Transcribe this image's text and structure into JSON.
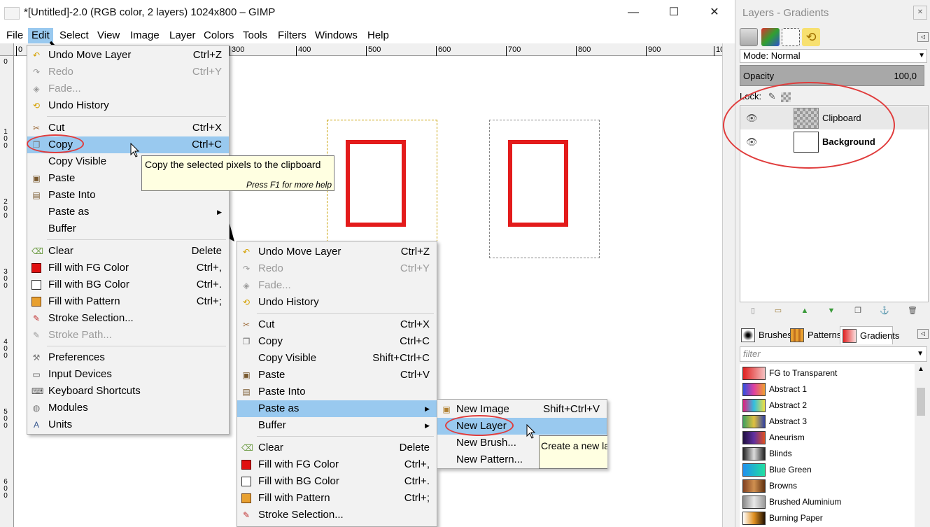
{
  "window": {
    "title": "*[Untitled]-2.0 (RGB color, 2 layers) 1024x800 – GIMP",
    "minimize": "—",
    "maximize": "☐",
    "close": "✕"
  },
  "menubar": [
    "File",
    "Edit",
    "Select",
    "View",
    "Image",
    "Layer",
    "Colors",
    "Tools",
    "Filters",
    "Windows",
    "Help"
  ],
  "ruler_h": [
    "0",
    "300",
    "400",
    "500",
    "600",
    "700",
    "800",
    "900",
    "10"
  ],
  "ruler_v": [
    "0",
    "100",
    "200",
    "300",
    "400",
    "500",
    "600"
  ],
  "edit_menu": [
    {
      "icon": "undo-icon",
      "label": "Undo Move Layer",
      "accel": "Ctrl+Z"
    },
    {
      "icon": "redo-icon",
      "label": "Redo",
      "accel": "Ctrl+Y",
      "disabled": true
    },
    {
      "icon": "fade-icon",
      "label": "Fade...",
      "accel": "",
      "disabled": true
    },
    {
      "icon": "undo-history-icon",
      "label": "Undo History",
      "accel": ""
    },
    {
      "icon": "cut-icon",
      "label": "Cut",
      "accel": "Ctrl+X"
    },
    {
      "icon": "copy-icon",
      "label": "Copy",
      "accel": "Ctrl+C",
      "highlighted": true
    },
    {
      "icon": "",
      "label": "Copy Visible",
      "accel": ""
    },
    {
      "icon": "paste-icon",
      "label": "Paste",
      "accel": ""
    },
    {
      "icon": "paste-into-icon",
      "label": "Paste Into",
      "accel": ""
    },
    {
      "icon": "",
      "label": "Paste as",
      "accel": "",
      "submenu": true
    },
    {
      "icon": "",
      "label": "Buffer",
      "accel": ""
    },
    {
      "icon": "clear-icon",
      "label": "Clear",
      "accel": "Delete"
    },
    {
      "icon": "fg-color-icon",
      "label": "Fill with FG Color",
      "accel": "Ctrl+,"
    },
    {
      "icon": "bg-color-icon",
      "label": "Fill with BG Color",
      "accel": "Ctrl+."
    },
    {
      "icon": "pattern-icon",
      "label": "Fill with Pattern",
      "accel": "Ctrl+;"
    },
    {
      "icon": "stroke-selection-icon",
      "label": "Stroke Selection...",
      "accel": ""
    },
    {
      "icon": "stroke-path-icon",
      "label": "Stroke Path...",
      "accel": "",
      "disabled": true
    },
    {
      "icon": "preferences-icon",
      "label": "Preferences",
      "accel": ""
    },
    {
      "icon": "input-devices-icon",
      "label": "Input Devices",
      "accel": ""
    },
    {
      "icon": "keyboard-icon",
      "label": "Keyboard Shortcuts",
      "accel": ""
    },
    {
      "icon": "modules-icon",
      "label": "Modules",
      "accel": ""
    },
    {
      "icon": "units-icon",
      "label": "Units",
      "accel": ""
    }
  ],
  "edit_menu2": [
    {
      "icon": "undo-icon",
      "label": "Undo Move Layer",
      "accel": "Ctrl+Z"
    },
    {
      "icon": "redo-icon",
      "label": "Redo",
      "accel": "Ctrl+Y",
      "disabled": true
    },
    {
      "icon": "fade-icon",
      "label": "Fade...",
      "accel": "",
      "disabled": true
    },
    {
      "icon": "undo-history-icon",
      "label": "Undo History",
      "accel": ""
    },
    {
      "icon": "cut-icon",
      "label": "Cut",
      "accel": "Ctrl+X"
    },
    {
      "icon": "copy-icon",
      "label": "Copy",
      "accel": "Ctrl+C"
    },
    {
      "icon": "",
      "label": "Copy Visible",
      "accel": "Shift+Ctrl+C"
    },
    {
      "icon": "paste-icon",
      "label": "Paste",
      "accel": "Ctrl+V"
    },
    {
      "icon": "paste-into-icon",
      "label": "Paste Into",
      "accel": ""
    },
    {
      "icon": "",
      "label": "Paste as",
      "accel": "",
      "submenu": true,
      "highlighted": true
    },
    {
      "icon": "",
      "label": "Buffer",
      "accel": "",
      "submenu": true
    },
    {
      "icon": "clear-icon",
      "label": "Clear",
      "accel": "Delete"
    },
    {
      "icon": "fg-color-icon",
      "label": "Fill with FG Color",
      "accel": "Ctrl+,"
    },
    {
      "icon": "bg-color-icon",
      "label": "Fill with BG Color",
      "accel": "Ctrl+."
    },
    {
      "icon": "pattern-icon",
      "label": "Fill with Pattern",
      "accel": "Ctrl+;"
    },
    {
      "icon": "stroke-selection-icon",
      "label": "Stroke Selection...",
      "accel": ""
    }
  ],
  "paste_as_menu": [
    {
      "icon": "new-image-icon",
      "label": "New Image",
      "accel": "Shift+Ctrl+V"
    },
    {
      "icon": "",
      "label": "New Layer",
      "accel": "",
      "highlighted": true
    },
    {
      "icon": "",
      "label": "New Brush...",
      "accel": ""
    },
    {
      "icon": "",
      "label": "New Pattern...",
      "accel": ""
    }
  ],
  "tooltip_copy": {
    "text": "Copy the selected pixels to the clipboard",
    "help": "Press F1 for more help"
  },
  "tooltip_new_layer": {
    "text": "Create a new la"
  },
  "dock": {
    "title": "Layers - Gradients",
    "mode": "Mode: Normal",
    "opacity_label": "Opacity",
    "opacity_value": "100,0",
    "lock_label": "Lock:",
    "layers": [
      {
        "name": "Clipboard",
        "bold": false
      },
      {
        "name": "Background",
        "bold": true
      }
    ],
    "resource_tabs": [
      "Brushes",
      "Patterns",
      "Gradients"
    ],
    "filter_placeholder": "filter",
    "gradients": [
      {
        "name": "FG to Transparent",
        "colors": [
          "#e02020",
          "#f4c0c0"
        ]
      },
      {
        "name": "Abstract 1",
        "colors": [
          "#3050e0",
          "#e040a0",
          "#f0a030"
        ]
      },
      {
        "name": "Abstract 2",
        "colors": [
          "#e02080",
          "#30c0e0",
          "#f0e040"
        ]
      },
      {
        "name": "Abstract 3",
        "colors": [
          "#40a060",
          "#e0c040",
          "#3040a0"
        ]
      },
      {
        "name": "Aneurism",
        "colors": [
          "#201040",
          "#6030a0",
          "#e05020"
        ]
      },
      {
        "name": "Blinds",
        "colors": [
          "#222222",
          "#dddddd",
          "#222222"
        ]
      },
      {
        "name": "Blue Green",
        "colors": [
          "#2090f0",
          "#20e0a0"
        ]
      },
      {
        "name": "Browns",
        "colors": [
          "#804020",
          "#d09050",
          "#603010"
        ]
      },
      {
        "name": "Brushed Aluminium",
        "colors": [
          "#8a8a8a",
          "#e8e8e8",
          "#9a9a9a"
        ]
      },
      {
        "name": "Burning Paper",
        "colors": [
          "#ffffff",
          "#e09020",
          "#201000"
        ]
      }
    ]
  }
}
